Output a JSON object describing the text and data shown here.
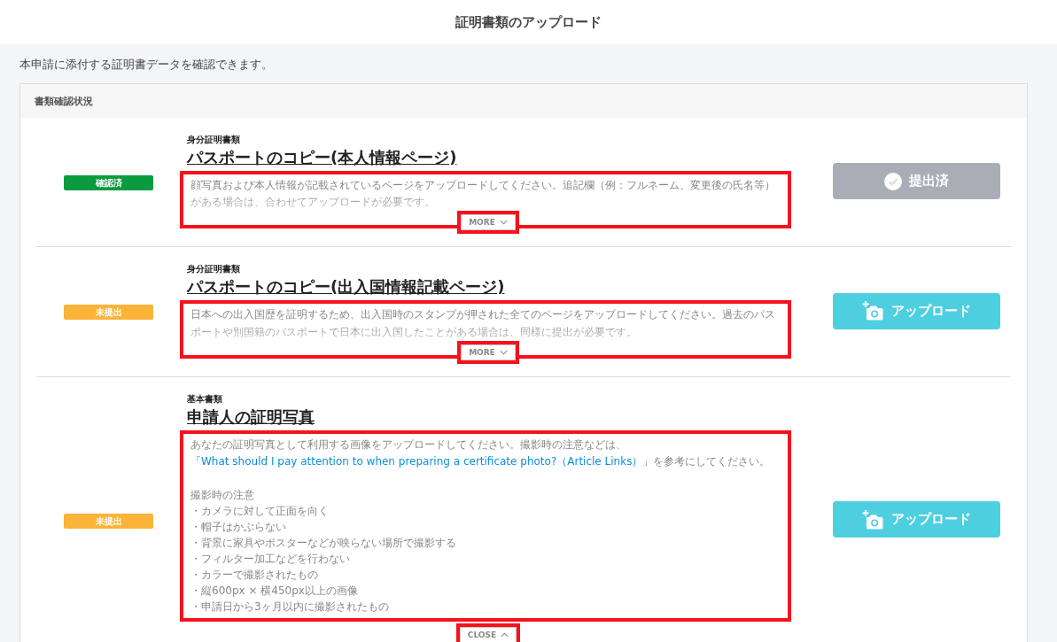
{
  "header": {
    "title": "証明書類のアップロード"
  },
  "intro": "本申請に添付する証明書データを確認できます。",
  "panel": {
    "title": "書類確認状況",
    "rows": [
      {
        "status": {
          "label": "確認済",
          "kind": "confirmed"
        },
        "category": "身分証明書類",
        "title": "パスポートのコピー(本人情報ページ)",
        "description": "顔写真および本人情報が記載されているページをアップロードしてください。追記欄（例：フルネーム、変更後の氏名等）がある場合は、合わせてアップロードが必要です。",
        "expanded": false,
        "toggle": "MORE",
        "highlighted": true,
        "button": {
          "label": "提出済",
          "kind": "submitted"
        }
      },
      {
        "status": {
          "label": "未提出",
          "kind": "missing"
        },
        "category": "身分証明書類",
        "title": "パスポートのコピー(出入国情報記載ページ)",
        "description": "日本への出入国歴を証明するため、出入国時のスタンプが押された全てのページをアップロードしてください。過去のパスポートや別国籍のパスポートで日本に出入国したことがある場合は、同様に提出が必要です。",
        "expanded": false,
        "toggle": "MORE",
        "highlighted": true,
        "button": {
          "label": "アップロード",
          "kind": "upload"
        }
      },
      {
        "status": {
          "label": "未提出",
          "kind": "missing"
        },
        "category": "基本書類",
        "title": "申請人の証明写真",
        "description": "あなたの証明写真として利用する画像をアップロードしてください。撮影時の注意などは、",
        "link": "「What should I pay attention to when preparing a certificate photo?（Article Links）」",
        "description_after": "を参考にしてください。",
        "notes_title": "撮影時の注意",
        "notes": [
          "・カメラに対して正面を向く",
          "・帽子はかぶらない",
          "・背景に家具やポスターなどが映らない場所で撮影する",
          "・フィルター加工などを行わない",
          "・カラーで撮影されたもの",
          "・縦600px × 横450px以上の画像",
          "・申請日から3ヶ月以内に撮影されたもの"
        ],
        "expanded": true,
        "toggle": "CLOSE",
        "highlighted": true,
        "button": {
          "label": "アップロード",
          "kind": "upload"
        }
      }
    ]
  }
}
